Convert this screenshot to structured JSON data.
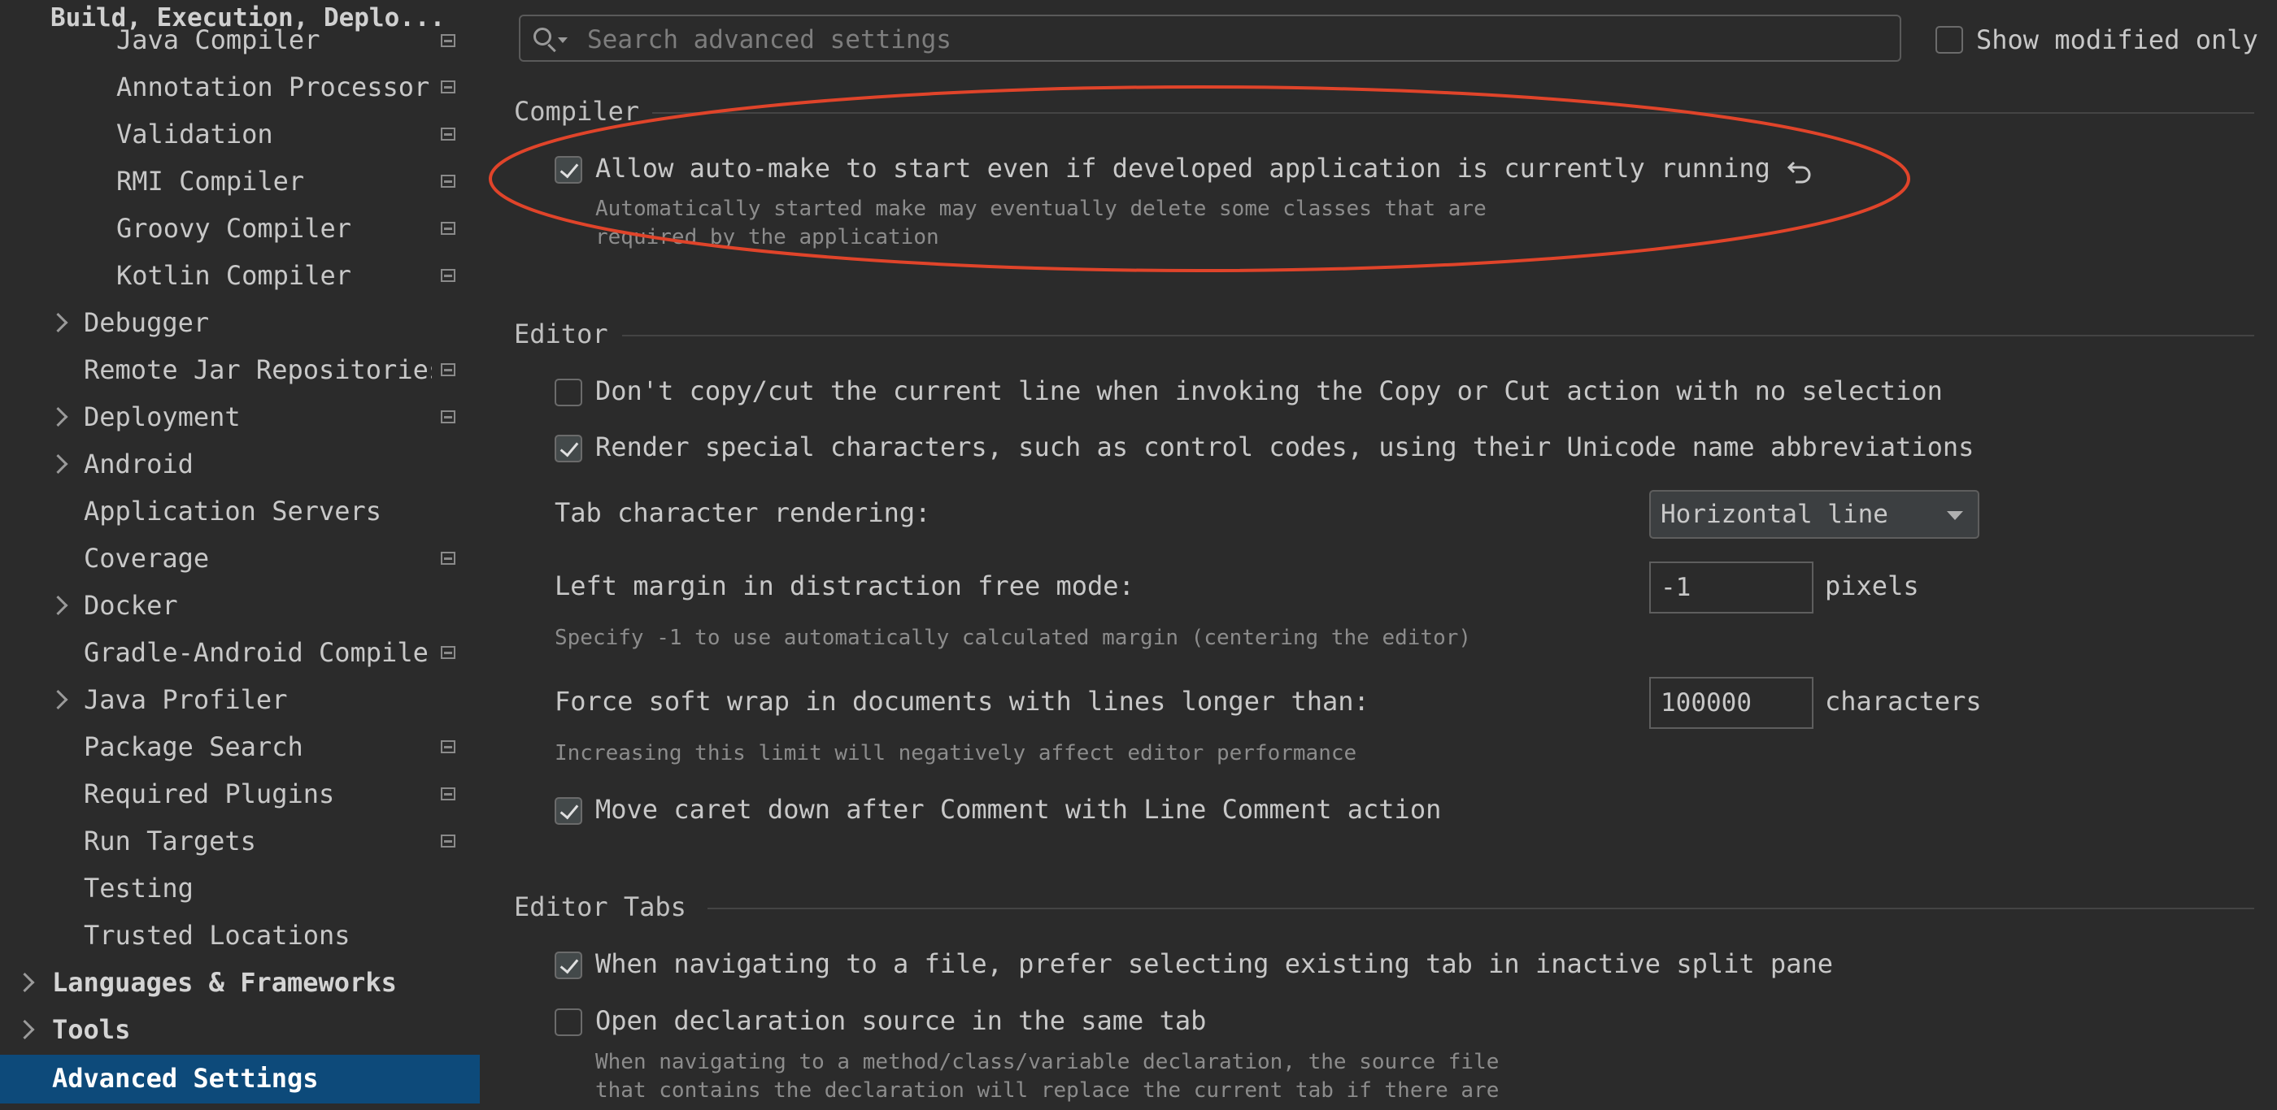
{
  "sidebar": {
    "header": "Build, Execution, Deplo...",
    "items": [
      {
        "label": "Java Compiler",
        "mod": true
      },
      {
        "label": "Annotation Processors",
        "mod": true
      },
      {
        "label": "Validation",
        "mod": true
      },
      {
        "label": "RMI Compiler",
        "mod": true
      },
      {
        "label": "Groovy Compiler",
        "mod": true
      },
      {
        "label": "Kotlin Compiler",
        "mod": true
      },
      {
        "label": "Debugger",
        "mod": false
      },
      {
        "label": "Remote Jar Repositories",
        "mod": true
      },
      {
        "label": "Deployment",
        "mod": true
      },
      {
        "label": "Android",
        "mod": false
      },
      {
        "label": "Application Servers",
        "mod": false
      },
      {
        "label": "Coverage",
        "mod": true
      },
      {
        "label": "Docker",
        "mod": false
      },
      {
        "label": "Gradle-Android Compiler",
        "mod": true
      },
      {
        "label": "Java Profiler",
        "mod": false
      },
      {
        "label": "Package Search",
        "mod": true
      },
      {
        "label": "Required Plugins",
        "mod": true
      },
      {
        "label": "Run Targets",
        "mod": true
      },
      {
        "label": "Testing",
        "mod": false
      },
      {
        "label": "Trusted Locations",
        "mod": false
      },
      {
        "label": "Languages & Frameworks",
        "mod": false
      },
      {
        "label": "Tools",
        "mod": false
      },
      {
        "label": "Advanced Settings",
        "mod": false,
        "selected": true
      }
    ]
  },
  "search": {
    "placeholder": "Search advanced settings",
    "value": ""
  },
  "show_modified": {
    "label": "Show modified only",
    "checked": false
  },
  "compiler": {
    "title": "Compiler",
    "auto_make": {
      "label": "Allow auto-make to start even if developed application is currently running",
      "checked": true,
      "hint1": "Automatically started make may eventually delete some classes that are",
      "hint2": "required by the application"
    }
  },
  "editor": {
    "title": "Editor",
    "no_copy": {
      "label": "Don't copy/cut the current line when invoking the Copy or Cut action with no selection",
      "checked": false
    },
    "render_special": {
      "label": "Render special characters, such as control codes, using their Unicode name abbreviations",
      "checked": true
    },
    "tab_rendering": {
      "label": "Tab character rendering:",
      "value": "Horizontal line"
    },
    "left_margin": {
      "label": "Left margin in distraction free mode:",
      "value": "-1",
      "unit": "pixels",
      "hint": "Specify -1 to use automatically calculated margin (centering the editor)"
    },
    "soft_wrap": {
      "label": "Force soft wrap in documents with lines longer than:",
      "value": "100000",
      "unit": "characters",
      "hint": "Increasing this limit will negatively affect editor performance"
    },
    "move_caret": {
      "label": "Move caret down after Comment with Line Comment action",
      "checked": true
    }
  },
  "editor_tabs": {
    "title": "Editor Tabs",
    "prefer_existing": {
      "label": "When navigating to a file, prefer selecting existing tab in inactive split pane",
      "checked": true
    },
    "open_same_tab": {
      "label": "Open declaration source in the same tab",
      "checked": false,
      "hint1": "When navigating to a method/class/variable declaration, the source file",
      "hint2": "that contains the declaration will replace the current tab if there are"
    }
  },
  "colors": {
    "background": "#2b2b2b",
    "selection": "#0d4a7a",
    "annotation": "#e0442a"
  }
}
